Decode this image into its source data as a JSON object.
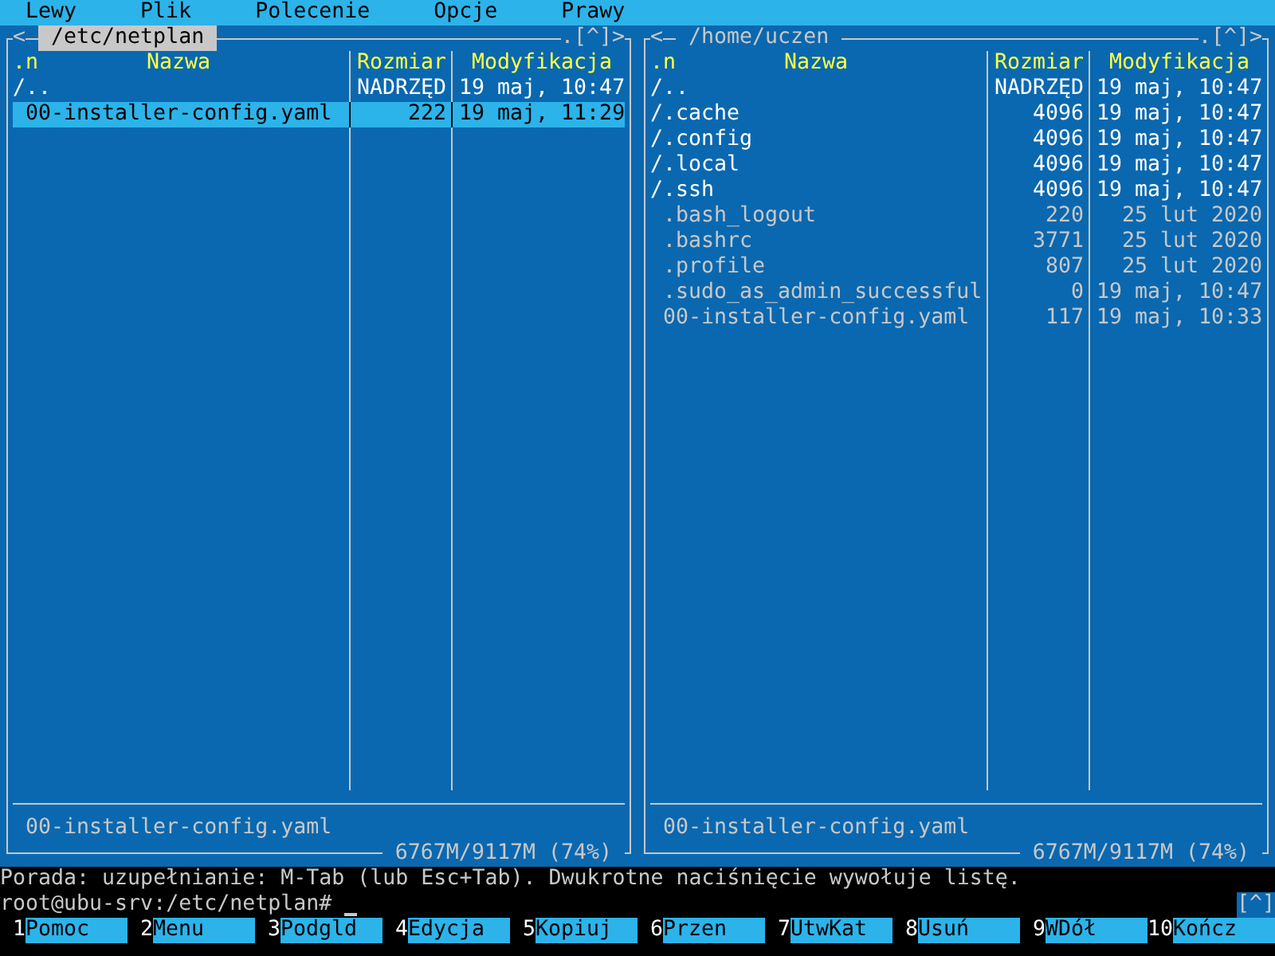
{
  "menu": [
    "Lewy",
    "Plik",
    "Polecenie",
    "Opcje",
    "Prawy"
  ],
  "panels": [
    {
      "path": "/etc/netplan",
      "active": true,
      "nav_left": "<",
      "nav_right": ".[^]>",
      "columns": [
        ".n",
        "Nazwa",
        "Rozmiar",
        "Modyfikacja"
      ],
      "rows": [
        {
          "name": "/..",
          "size": "NADRZĘD",
          "modified": "19 maj, 10:47",
          "kind": "dir",
          "selected": false
        },
        {
          "name": "00-installer-config.yaml",
          "size": "222",
          "modified": "19 maj, 11:29",
          "kind": "file",
          "selected": true
        }
      ],
      "status_name": "00-installer-config.yaml",
      "disk": "6767M/9117M (74%)"
    },
    {
      "path": "/home/uczen",
      "active": false,
      "nav_left": "<",
      "nav_right": ".[^]>",
      "columns": [
        ".n",
        "Nazwa",
        "Rozmiar",
        "Modyfikacja"
      ],
      "rows": [
        {
          "name": "/..",
          "size": "NADRZĘD",
          "modified": "19 maj, 10:47",
          "kind": "dir",
          "selected": false
        },
        {
          "name": "/.cache",
          "size": "4096",
          "modified": "19 maj, 10:47",
          "kind": "dir",
          "selected": false
        },
        {
          "name": "/.config",
          "size": "4096",
          "modified": "19 maj, 10:47",
          "kind": "dir",
          "selected": false
        },
        {
          "name": "/.local",
          "size": "4096",
          "modified": "19 maj, 10:47",
          "kind": "dir",
          "selected": false
        },
        {
          "name": "/.ssh",
          "size": "4096",
          "modified": "19 maj, 10:47",
          "kind": "dir",
          "selected": false
        },
        {
          "name": ".bash_logout",
          "size": "220",
          "modified": "25 lut 2020",
          "kind": "file",
          "selected": false
        },
        {
          "name": ".bashrc",
          "size": "3771",
          "modified": "25 lut 2020",
          "kind": "file",
          "selected": false
        },
        {
          "name": ".profile",
          "size": "807",
          "modified": "25 lut 2020",
          "kind": "file",
          "selected": false
        },
        {
          "name": ".sudo_as_admin_successful",
          "size": "0",
          "modified": "19 maj, 10:47",
          "kind": "file",
          "selected": false
        },
        {
          "name": "00-installer-config.yaml",
          "size": "117",
          "modified": "19 maj, 10:33",
          "kind": "file",
          "selected": false
        }
      ],
      "status_name": "00-installer-config.yaml",
      "disk": "6767M/9117M (74%)"
    }
  ],
  "hint": "Porada: uzupełnianie: M-Tab (lub Esc+Tab). Dwukrotne naciśnięcie wywołuje listę.",
  "prompt": "root@ubu-srv:/etc/netplan#",
  "scroll_marker": "[^]",
  "keys": [
    {
      "number": "1",
      "label": "Pomoc"
    },
    {
      "number": "2",
      "label": "Menu"
    },
    {
      "number": "3",
      "label": "Podgld"
    },
    {
      "number": "4",
      "label": "Edycja"
    },
    {
      "number": "5",
      "label": "Kopiuj"
    },
    {
      "number": "6",
      "label": "Przen"
    },
    {
      "number": "7",
      "label": "UtwKat"
    },
    {
      "number": "8",
      "label": "Usuń"
    },
    {
      "number": "9",
      "label": "WDół"
    },
    {
      "number": "10",
      "label": "Kończ"
    }
  ]
}
